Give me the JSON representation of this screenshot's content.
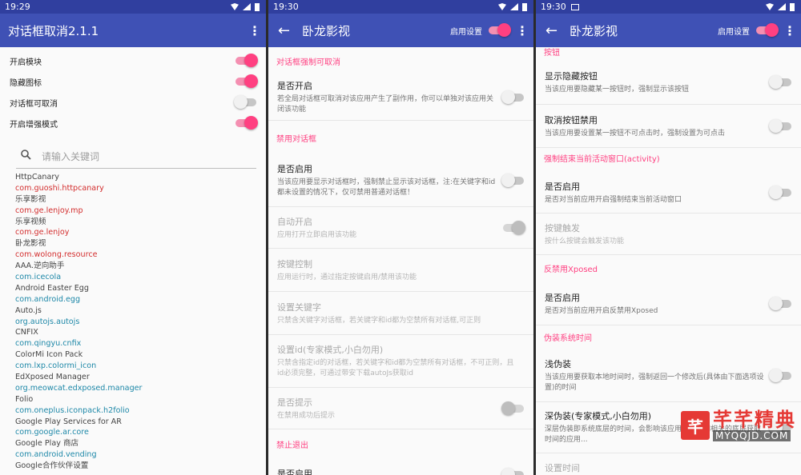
{
  "screen1": {
    "time": "19:29",
    "title": "对话框取消2.1.1",
    "menu_icon": "⋮",
    "toggles": [
      {
        "label": "开启模块",
        "on": true
      },
      {
        "label": "隐藏图标",
        "on": true
      },
      {
        "label": "对话框可取消",
        "on": false
      },
      {
        "label": "开启增强模式",
        "on": true
      }
    ],
    "search_placeholder": "请输入关键词",
    "packages": [
      {
        "text": "HttpCanary",
        "kind": "name"
      },
      {
        "text": "com.guoshi.httpcanary",
        "kind": "red"
      },
      {
        "text": "乐享影视",
        "kind": "name"
      },
      {
        "text": "com.ge.lenjoy.mp",
        "kind": "red"
      },
      {
        "text": "乐享视频",
        "kind": "name"
      },
      {
        "text": "com.ge.lenjoy",
        "kind": "red"
      },
      {
        "text": "卧龙影视",
        "kind": "name"
      },
      {
        "text": "com.wolong.resource",
        "kind": "red"
      },
      {
        "text": "AAA.逆向助手",
        "kind": "name"
      },
      {
        "text": "com.icecola",
        "kind": "teal"
      },
      {
        "text": "Android Easter Egg",
        "kind": "name"
      },
      {
        "text": "com.android.egg",
        "kind": "teal"
      },
      {
        "text": "Auto.js",
        "kind": "name"
      },
      {
        "text": "org.autojs.autojs",
        "kind": "teal"
      },
      {
        "text": "CNFIX",
        "kind": "name"
      },
      {
        "text": "com.qingyu.cnfix",
        "kind": "teal"
      },
      {
        "text": "ColorMi Icon Pack",
        "kind": "name"
      },
      {
        "text": "com.lxp.colormi_icon",
        "kind": "teal"
      },
      {
        "text": "EdXposed Manager",
        "kind": "name"
      },
      {
        "text": "org.meowcat.edxposed.manager",
        "kind": "teal"
      },
      {
        "text": "Folio",
        "kind": "name"
      },
      {
        "text": "com.oneplus.iconpack.h2folio",
        "kind": "teal"
      },
      {
        "text": "Google Play Services for AR",
        "kind": "name"
      },
      {
        "text": "com.google.ar.core",
        "kind": "teal"
      },
      {
        "text": "Google Play 商店",
        "kind": "name"
      },
      {
        "text": "com.android.vending",
        "kind": "teal"
      },
      {
        "text": "Google合作伙伴设置",
        "kind": "name"
      }
    ]
  },
  "screen2": {
    "time": "19:30",
    "back_icon": "←",
    "title": "卧龙影视",
    "enable_label": "启用设置",
    "enable_on": true,
    "menu_icon": "⋮",
    "sections": [
      {
        "header": "对话框强制可取消",
        "items": [
          {
            "title": "是否开启",
            "summary": "若全局对话框可取消对该应用产生了副作用，你可以单独对该应用关闭该功能",
            "switch": "off",
            "disabled": false
          }
        ]
      },
      {
        "header": "禁用对话框",
        "items": [
          {
            "title": "是否启用",
            "summary": "当该应用要显示对话框时，强制禁止显示该对话框，注:在关键字和id都未设置的情况下，仅可禁用普通对话框！",
            "switch": "off",
            "disabled": false
          },
          {
            "title": "自动开启",
            "summary": "应用打开立即启用该功能",
            "switch": "on",
            "disabled": true
          },
          {
            "title": "按键控制",
            "summary": "应用运行时，通过指定按键启用/禁用该功能",
            "switch": "",
            "disabled": true
          },
          {
            "title": "设置关键字",
            "summary": "只禁含关键字对话框，若关键字和id都为空禁所有对话框,可正则",
            "switch": "",
            "disabled": true
          },
          {
            "title": "设置id(专家模式,小白勿用)",
            "summary": "只禁含指定id的对话框，若关键字和id都为空禁所有对话框，不可正则，且id必须完整，可通过带安下载autoJs获取id",
            "switch": "",
            "disabled": true
          },
          {
            "title": "是否提示",
            "summary": "在禁用成功后提示",
            "switch": "off",
            "disabled": true
          }
        ]
      },
      {
        "header": "禁止退出",
        "items": [
          {
            "title": "是否启用",
            "summary": "",
            "switch": "off",
            "disabled": false
          }
        ]
      }
    ]
  },
  "screen3": {
    "time": "19:30",
    "back_icon": "←",
    "title": "卧龙影视",
    "enable_label": "启用设置",
    "enable_on": true,
    "menu_icon": "⋮",
    "sections": [
      {
        "header": "按钮",
        "items": [
          {
            "title": "显示隐藏按钮",
            "summary": "当该应用要隐藏某一按钮时，强制显示该按钮",
            "switch": "off",
            "disabled": false
          },
          {
            "title": "取消按钮禁用",
            "summary": "当该应用要设置某一按钮不可点击时，强制设置为可点击",
            "switch": "off",
            "disabled": false
          }
        ]
      },
      {
        "header": "强制结束当前活动窗口(activity)",
        "items": [
          {
            "title": "是否启用",
            "summary": "是否对当前应用开启强制结束当前活动窗口",
            "switch": "off",
            "disabled": false
          },
          {
            "title": "按键触发",
            "summary": "按什么按键会触发该功能",
            "switch": "",
            "disabled": true
          }
        ]
      },
      {
        "header": "反禁用Xposed",
        "items": [
          {
            "title": "是否启用",
            "summary": "是否对当前应用开启反禁用Xposed",
            "switch": "off",
            "disabled": false
          }
        ]
      },
      {
        "header": "伪装系统时间",
        "items": [
          {
            "title": "浅伪装",
            "summary": "当该应用要获取本地时间时，强制返回一个修改后(具体由下面选项设置)的时间",
            "switch": "off",
            "disabled": false
          },
          {
            "title": "深伪装(专家模式,小白勿用)",
            "summary": "深层伪装即系统底层的时间，会影响该应用所有时间相关的底层获取时间的应用...",
            "switch": "off",
            "disabled": false
          },
          {
            "title": "设置时间",
            "summary": "",
            "switch": "",
            "disabled": true
          }
        ]
      }
    ]
  },
  "watermark": {
    "logo": "芊",
    "text": "芊芊精典",
    "domain": "MYQQJD.COM"
  }
}
